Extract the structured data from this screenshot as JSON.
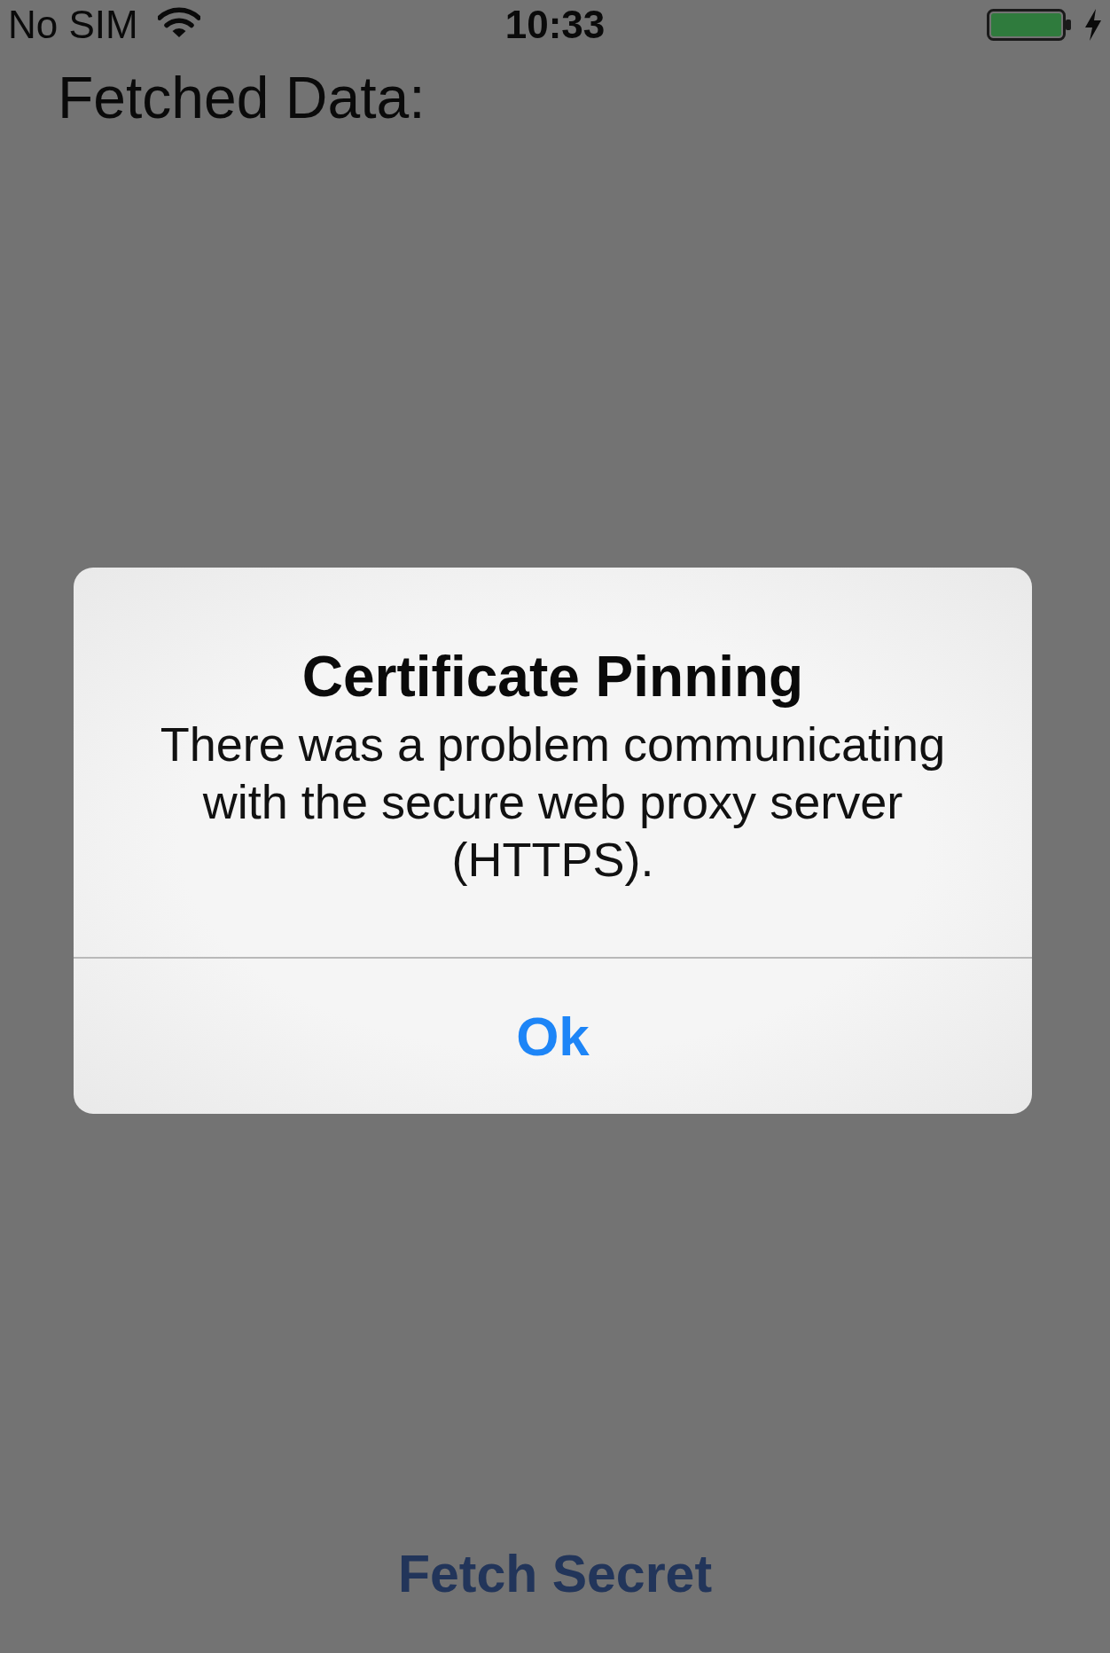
{
  "status_bar": {
    "carrier": "No SIM",
    "time": "10:33"
  },
  "screen": {
    "heading": "Fetched Data:",
    "button": "Fetch Secret"
  },
  "alert": {
    "title": "Certificate Pinning",
    "message": "There was a problem communicating with the secure web proxy server (HTTPS).",
    "buttons": [
      "Ok"
    ]
  }
}
